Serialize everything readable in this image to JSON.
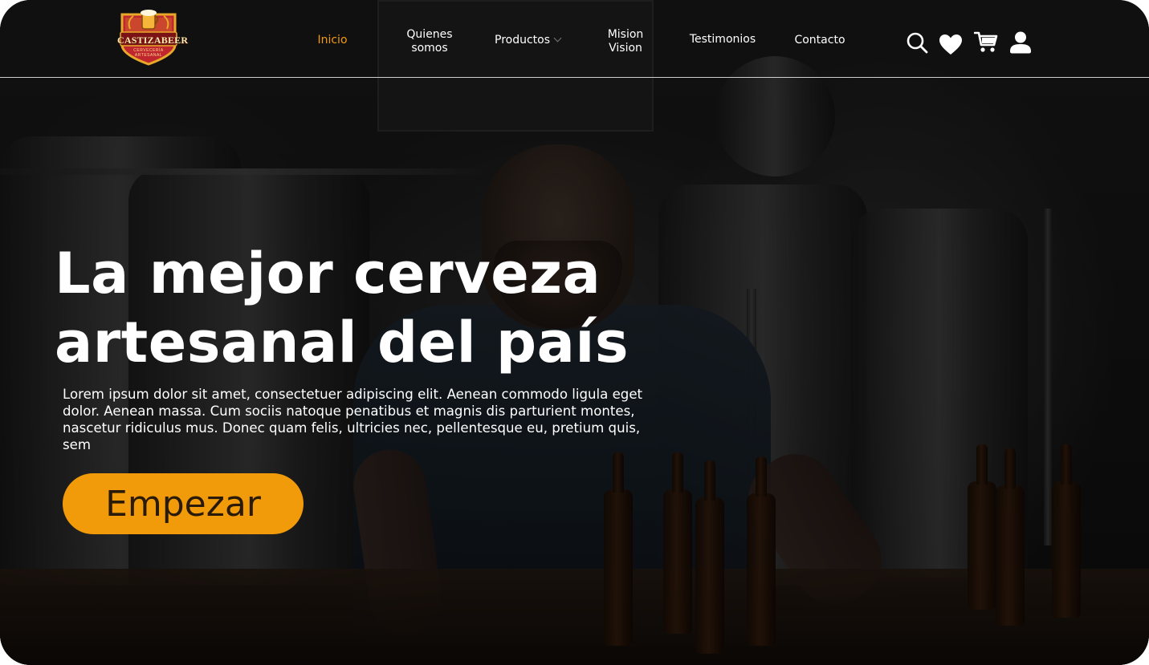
{
  "brand": {
    "name": "CASTIZABEER",
    "tagline_line1": "CERVECERÍA",
    "tagline_line2": "ARTESANAL",
    "colors": {
      "accent": "#f29b0a",
      "shield_red": "#c0262d",
      "gold": "#e8a92a"
    }
  },
  "nav": {
    "items": [
      {
        "label": "Inicio",
        "active": true
      },
      {
        "label_line1": "Quienes",
        "label_line2": "somos"
      },
      {
        "label": "Productos",
        "has_dropdown": true
      },
      {
        "label_line1": "Mision",
        "label_line2": "Vision"
      },
      {
        "label": "Testimonios"
      },
      {
        "label": "Contacto"
      }
    ]
  },
  "header_icons": [
    "search-icon",
    "heart-icon",
    "cart-icon",
    "user-icon"
  ],
  "hero": {
    "title_line1": "La mejor cerveza",
    "title_line2": "artesanal del país",
    "body": "Lorem ipsum dolor sit amet, consectetuer adipiscing elit. Aenean commodo ligula eget dolor. Aenean massa. Cum sociis natoque penatibus et magnis dis parturient montes, nascetur ridiculus mus. Donec quam felis, ultricies nec, pellentesque eu, pretium quis, sem",
    "cta_label": "Empezar"
  }
}
